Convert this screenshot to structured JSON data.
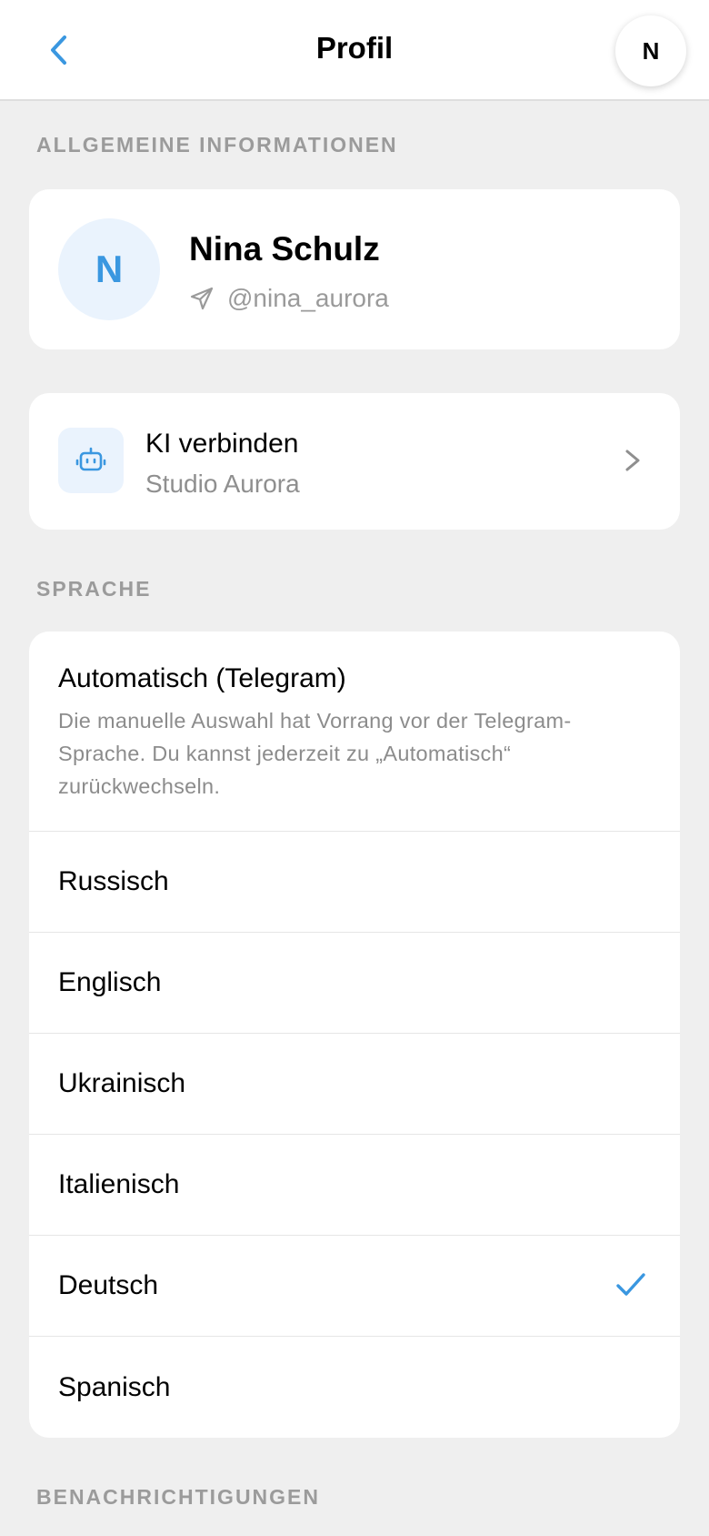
{
  "header": {
    "title": "Profil",
    "avatar_initial": "N"
  },
  "sections": {
    "general": "ALLGEMEINE INFORMATIONEN",
    "language": "SPRACHE",
    "notifications": "BENACHRICHTIGUNGEN"
  },
  "profile": {
    "initial": "N",
    "name": "Nina Schulz",
    "handle": "@nina_aurora"
  },
  "ai": {
    "title": "KI verbinden",
    "subtitle": "Studio Aurora"
  },
  "language": {
    "auto_title": "Automatisch (Telegram)",
    "auto_desc": "Die manuelle Auswahl hat Vorrang vor der Telegram-Sprache. Du kannst jederzeit zu „Automatisch“ zurückwechseln.",
    "options": [
      {
        "label": "Russisch",
        "selected": false
      },
      {
        "label": "Englisch",
        "selected": false
      },
      {
        "label": "Ukrainisch",
        "selected": false
      },
      {
        "label": "Italienisch",
        "selected": false
      },
      {
        "label": "Deutsch",
        "selected": true
      },
      {
        "label": "Spanisch",
        "selected": false
      }
    ]
  },
  "colors": {
    "accent": "#3a97e0",
    "background": "#efefef",
    "card": "#ffffff",
    "muted": "#9b9b9b"
  },
  "icons": {
    "back": "chevron-left-icon",
    "handle": "send-icon",
    "ai": "robot-icon",
    "ai_chevron": "chevron-right-icon",
    "selected": "checkmark-icon"
  }
}
